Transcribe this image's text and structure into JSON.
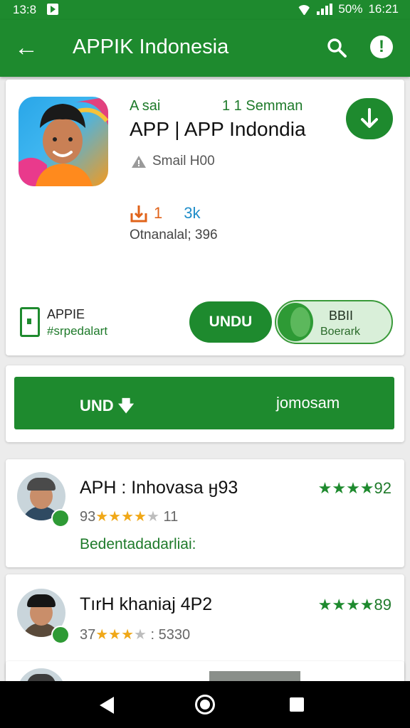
{
  "status": {
    "time_left": "13:8",
    "battery": "50%",
    "time_right": "16:21"
  },
  "appbar": {
    "title": "APPIK Indonesia"
  },
  "app": {
    "top_left": "A sai",
    "top_right": "1 1 Semman",
    "title": "APP | APP Indondia",
    "developer": "Smail H00",
    "stat1": "1",
    "stat2": "3k",
    "stat_sub": "Otnanalal; 396",
    "label1": "APPIE",
    "label2": "#srpedalart",
    "btn_install": "UNDU",
    "btn2_top": "BBII",
    "btn2_bottom": "Boerark"
  },
  "big_button": {
    "left": "UND",
    "right": "jomosam"
  },
  "reviews": [
    {
      "name": "APH : Inhovasa ӈ93",
      "rating_top": "92",
      "rating_line": "93",
      "rating_count": "11",
      "comment": "Bedentadadarliai:"
    },
    {
      "name": "TırH khaniaj 4P2",
      "rating_top": "89",
      "rating_line": "37",
      "rating_count": ": 5330",
      "comment": ""
    }
  ],
  "icons": {
    "back": "arrow-left-icon",
    "search": "search-icon",
    "info": "info-icon",
    "download": "download-icon",
    "developer": "warning-icon",
    "phone": "phone-icon",
    "star": "star-icon"
  },
  "colors": {
    "primary": "#1e8a2e",
    "accent_orange": "#e0631a",
    "accent_blue": "#1f8dc9",
    "star": "#f0a818"
  }
}
